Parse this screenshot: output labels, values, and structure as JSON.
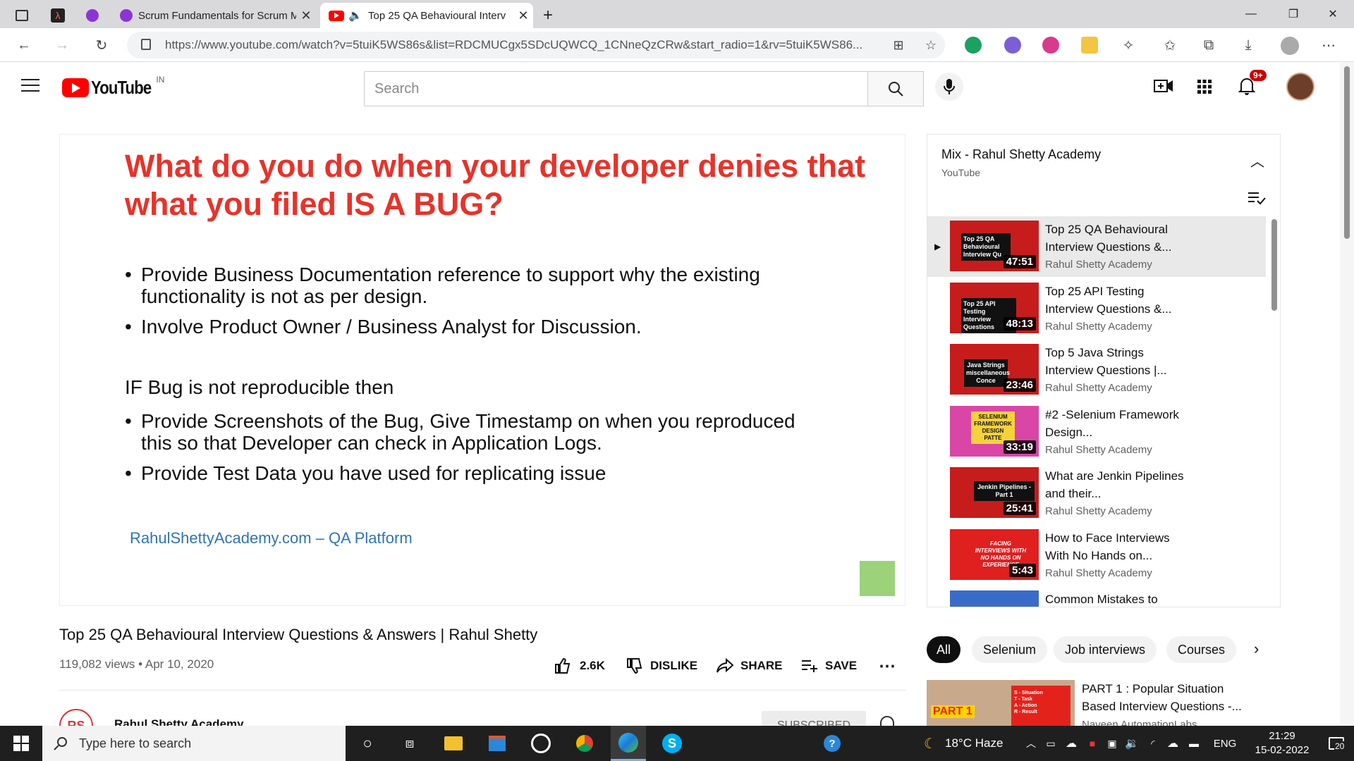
{
  "browser": {
    "tabs": [
      {
        "label": "",
        "icon": "grid-icon"
      },
      {
        "label": "",
        "icon": "app-icon"
      },
      {
        "label": "",
        "icon": "purple-circle-icon"
      },
      {
        "label": "Scrum Fundamentals for Scrum M",
        "icon": "purple-circle-icon"
      },
      {
        "label": "Top 25 QA Behavioural Interv",
        "icon": "youtube-icon"
      }
    ],
    "url": "https://www.youtube.com/watch?v=5tuiK5WS86s&list=RDCMUCgx5SDcUQWCQ_1CNneQzCRw&start_radio=1&rv=5tuiK5WS86...",
    "colors": {
      "tabstrip": "#d9d9dc",
      "active_tab": "#ffffff"
    }
  },
  "youtube": {
    "logo_text": "YouTube",
    "region": "IN",
    "search_placeholder": "Search",
    "notification_count": "9+",
    "accent": "#ff0000"
  },
  "slide": {
    "heading_line1": "What do you do when your developer denies that",
    "heading_line2": "what you filed IS A BUG?",
    "bullets1": [
      {
        "line1": "Provide Business Documentation reference to support why the existing",
        "line2": "functionality is not as per design."
      },
      {
        "line1": "Involve Product Owner / Business Analyst for Discussion.",
        "line2": ""
      }
    ],
    "subheading": "IF Bug is not reproducible then",
    "bullets2": [
      {
        "line1": "Provide Screenshots of the Bug, Give Timestamp on when you reproduced",
        "line2": "this so that Developer can check in Application Logs."
      },
      {
        "line1": "Provide Test Data you have used for replicating issue",
        "line2": ""
      }
    ],
    "footer": "RahulShettyAcademy.com – QA Platform",
    "heading_color": "#e8322a",
    "footer_color": "#2e74b5"
  },
  "video": {
    "title": "Top 25 QA Behavioural Interview Questions & Answers | Rahul Shetty",
    "views": "119,082 views",
    "date": "Apr 10, 2020",
    "like_count": "2.6K",
    "dislike_label": "DISLIKE",
    "share_label": "SHARE",
    "save_label": "SAVE",
    "channel_name": "Rahul Shetty Academy",
    "subscribe_label": "SUBSCRIBED"
  },
  "playlist": {
    "title": "Mix - Rahul Shetty Academy",
    "subtitle": "YouTube",
    "items": [
      {
        "title": "Top 25 QA Behavioural Interview Questions &...",
        "channel": "Rahul Shetty Academy",
        "duration": "47:51",
        "thumb_text": "Top 25 QA Behavioural Interview Qu",
        "playing": true
      },
      {
        "title": "Top 25 API Testing Interview Questions &...",
        "channel": "Rahul Shetty Academy",
        "duration": "48:13",
        "thumb_text": "Top 25 API Testing Interview Questions",
        "playing": false
      },
      {
        "title": "Top 5 Java Strings Interview Questions |...",
        "channel": "Rahul Shetty Academy",
        "duration": "23:46",
        "thumb_text": "Java Strings miscellaneous Conce",
        "playing": false
      },
      {
        "title": "#2 -Selenium Framework Design...",
        "channel": "Rahul Shetty Academy",
        "duration": "33:19",
        "thumb_text": "SELENIUM FRAMEWORK DESIGN PATTE",
        "playing": false
      },
      {
        "title": "What are Jenkin Pipelines and their...",
        "channel": "Rahul Shetty Academy",
        "duration": "25:41",
        "thumb_text": "Jenkin Pipelines -Part 1",
        "playing": false
      },
      {
        "title": "How to Face Interviews With No Hands on...",
        "channel": "Rahul Shetty Academy",
        "duration": "5:43",
        "thumb_text": "FACING INTERVIEWS WITH NO HANDS ON EXPERIENCE",
        "playing": false
      },
      {
        "title": "Common Mistakes to",
        "channel": "",
        "duration": "",
        "thumb_text": "",
        "playing": false
      }
    ]
  },
  "chips": [
    "All",
    "Selenium",
    "Job interviews",
    "Courses"
  ],
  "recommendation": {
    "title_line1": "PART 1 : Popular Situation",
    "title_line2": "Based Interview Questions -...",
    "channel": "Naveen AutomationLabs",
    "thumb_text": "PART 1",
    "thumb_lines": [
      "S - Situation",
      "T - Task",
      "A - Action",
      "R - Result"
    ]
  },
  "taskbar": {
    "search_placeholder": "Type here to search",
    "weather": "18°C  Haze",
    "language": "ENG",
    "time": "21:29",
    "date": "15-02-2022",
    "notification_count": "20"
  }
}
